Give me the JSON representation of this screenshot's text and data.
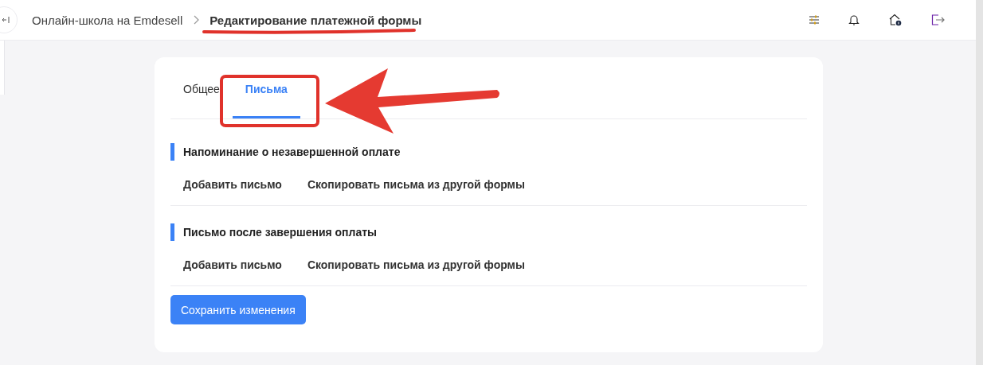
{
  "header": {
    "breadcrumbs": [
      {
        "label": "Онлайн-школа на Emdesell",
        "current": false
      },
      {
        "label": "Редактирование платежной формы",
        "current": true
      }
    ]
  },
  "tabs": [
    {
      "label": "Общее",
      "selected": false
    },
    {
      "label": "Письма",
      "selected": true
    }
  ],
  "sections": [
    {
      "title": "Напоминание о незавершенной оплате",
      "actions": [
        "Добавить письмо",
        "Скопировать письма из другой формы"
      ]
    },
    {
      "title": "Письмо после завершения оплаты",
      "actions": [
        "Добавить письмо",
        "Скопировать письма из другой формы"
      ]
    }
  ],
  "save_button": "Сохранить изменения"
}
